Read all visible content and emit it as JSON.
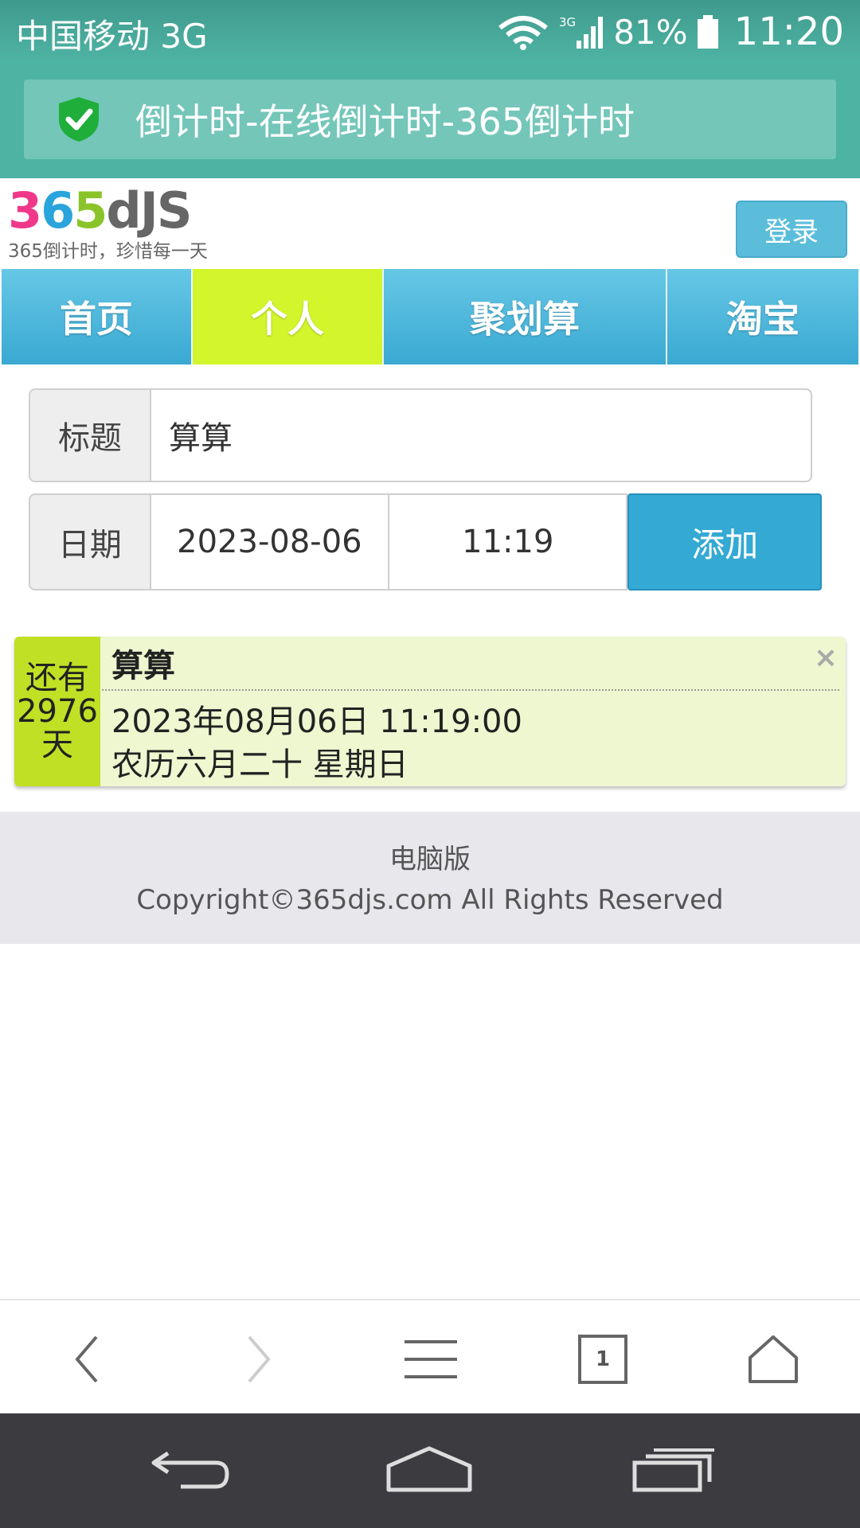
{
  "status_bar": {
    "carrier": "中国移动 3G",
    "network": "3G",
    "battery": "81%",
    "time": "11:20",
    "icons": [
      "wifi-icon",
      "signal-icon",
      "battery-icon"
    ]
  },
  "url_bar": {
    "security_icon": "shield-check-icon",
    "title": "倒计时-在线倒计时-365倒计时"
  },
  "header": {
    "logo": {
      "p1": "3",
      "p2": "6",
      "p3": "5",
      "p4": "dJS"
    },
    "slogan": "365倒计时，珍惜每一天",
    "login_label": "登录"
  },
  "nav": {
    "items": [
      {
        "label": "首页",
        "active": false
      },
      {
        "label": "个人",
        "active": true
      },
      {
        "label": "聚划算",
        "active": false
      },
      {
        "label": "淘宝",
        "active": false
      }
    ]
  },
  "form": {
    "title_label": "标题",
    "title_value": "算算",
    "date_label": "日期",
    "date_value": "2023-08-06",
    "time_value": "11:19",
    "add_label": "添加"
  },
  "countdown": {
    "prefix": "还有",
    "days": "2976",
    "unit": "天",
    "title": "算算",
    "datetime": "2023年08月06日 11:19:00",
    "lunar": "农历六月二十 星期日",
    "close": "×"
  },
  "footer": {
    "desktop_link": "电脑版",
    "copyright": "Copyright©365djs.com All Rights Reserved"
  },
  "browser_toolbar": {
    "tab_count": "1",
    "icons": [
      "back-icon",
      "forward-icon",
      "menu-icon",
      "tabs-icon",
      "home-icon"
    ]
  },
  "system_nav": {
    "icons": [
      "system-back-icon",
      "system-home-icon",
      "recents-icon"
    ]
  },
  "colors": {
    "status_bar": "#3f9a8d",
    "url_bar": "#4db3a2",
    "nav_blue": "#3aa9d2",
    "nav_active": "#d2f52b",
    "days_badge": "#bfe024",
    "card_bg": "#eef7d0",
    "add_button": "#33a9d4"
  }
}
